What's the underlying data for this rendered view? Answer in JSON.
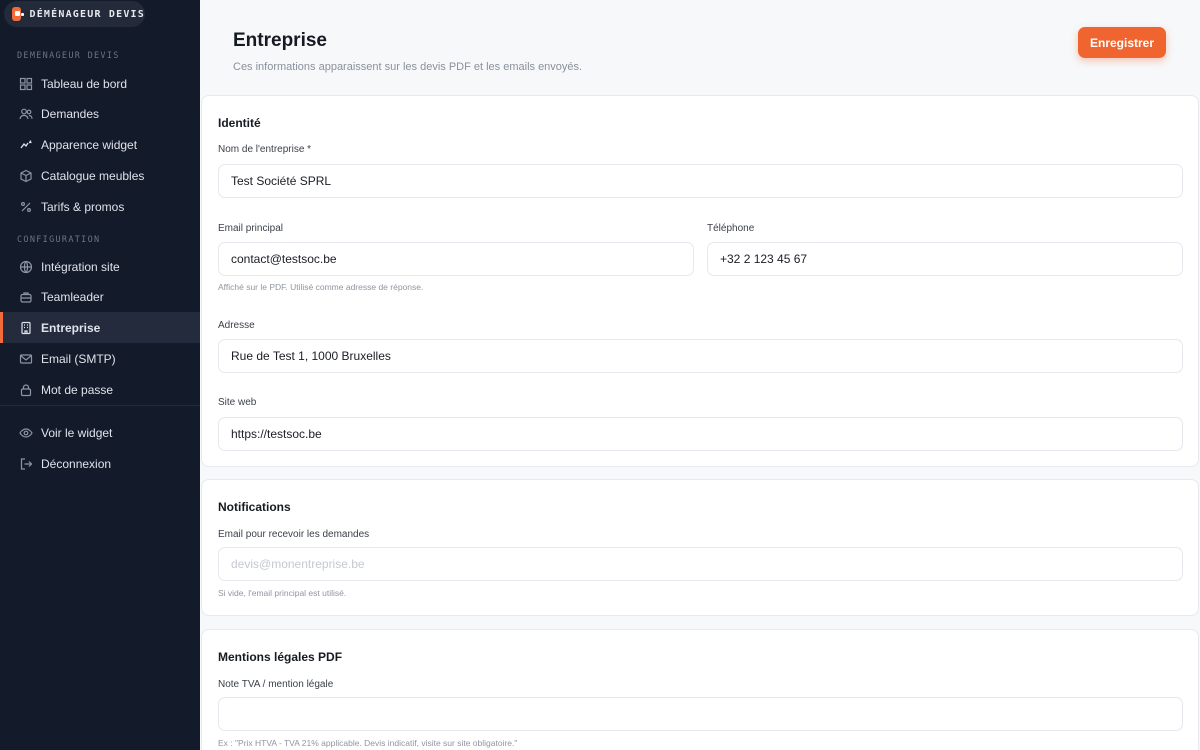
{
  "brand": {
    "name": "DÉMÉNAGEUR DEVIS"
  },
  "sidebar": {
    "section1_label": "DEMENAGEUR DEVIS",
    "section2_label": "CONFIGURATION",
    "items": [
      {
        "label": "Tableau de bord",
        "icon": "dashboard-icon"
      },
      {
        "label": "Demandes",
        "icon": "users-icon"
      },
      {
        "label": "Apparence widget",
        "icon": "magic-wand-icon"
      },
      {
        "label": "Catalogue meubles",
        "icon": "cube-icon"
      },
      {
        "label": "Tarifs & promos",
        "icon": "percent-icon"
      },
      {
        "label": "Intégration site",
        "icon": "globe-icon"
      },
      {
        "label": "Teamleader",
        "icon": "briefcase-icon"
      },
      {
        "label": "Entreprise",
        "icon": "building-icon",
        "active": true
      },
      {
        "label": "Email (SMTP)",
        "icon": "mail-icon"
      },
      {
        "label": "Mot de passe",
        "icon": "lock-icon"
      },
      {
        "label": "Voir le widget",
        "icon": "eye-icon"
      },
      {
        "label": "Déconnexion",
        "icon": "logout-icon"
      }
    ]
  },
  "header": {
    "title": "Entreprise",
    "subtitle": "Ces informations apparaissent sur les devis PDF et les emails envoyés.",
    "save_label": "Enregistrer"
  },
  "identity": {
    "title": "Identité",
    "company_name_label": "Nom de l'entreprise *",
    "company_name_value": "Test Société SPRL",
    "email_label": "Email principal",
    "email_value": "contact@testsoc.be",
    "email_hint": "Affiché sur le PDF. Utilisé comme adresse de réponse.",
    "phone_label": "Téléphone",
    "phone_value": "+32 2 123 45 67",
    "address_label": "Adresse",
    "address_value": "Rue de Test 1, 1000 Bruxelles",
    "website_label": "Site web",
    "website_value": "https://testsoc.be"
  },
  "notifications": {
    "title": "Notifications",
    "email_label": "Email pour recevoir les demandes",
    "email_placeholder": "devis@monentreprise.be",
    "email_hint": "Si vide, l'email principal est utilisé."
  },
  "legal": {
    "title": "Mentions légales PDF",
    "vat_label": "Note TVA / mention légale",
    "vat_value": "",
    "vat_hint": "Ex : \"Prix HTVA - TVA 21% applicable. Devis indicatif, visite sur site obligatoire.\""
  },
  "colors": {
    "accent": "#f0642f",
    "sidebar_bg": "#131a2a"
  }
}
